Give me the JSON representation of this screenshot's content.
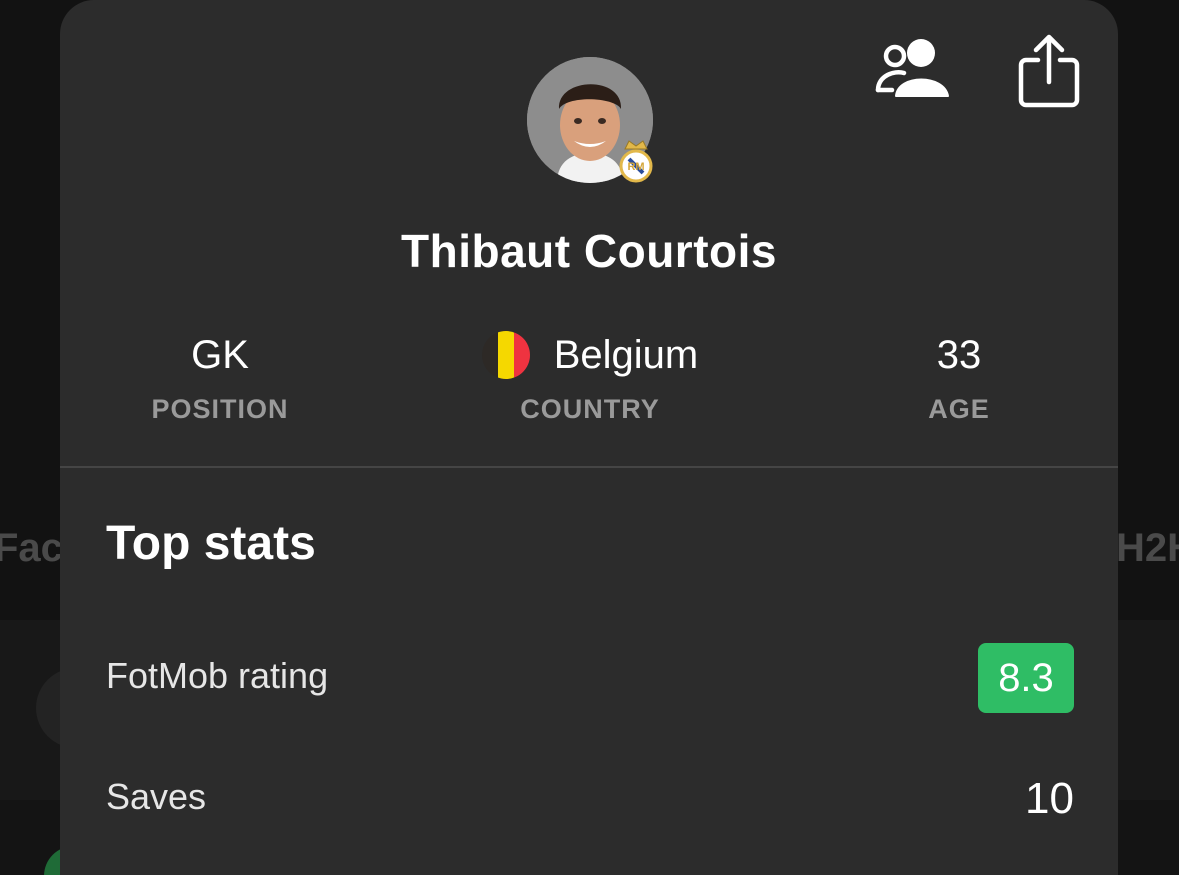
{
  "background": {
    "tab_left_fragment": "Fac",
    "tab_right_fragment": "H2H"
  },
  "header_icons": [
    "compare-players-icon",
    "share-icon"
  ],
  "player": {
    "name": "Thibaut Courtois",
    "club_badge_icon": "real-madrid-crest-icon"
  },
  "info": {
    "position": {
      "value": "GK",
      "label": "POSITION"
    },
    "country": {
      "value": "Belgium",
      "label": "COUNTRY",
      "flag_colors": [
        "#2d2926",
        "#f5d800",
        "#ef3340"
      ]
    },
    "age": {
      "value": "33",
      "label": "AGE"
    }
  },
  "top_stats": {
    "title": "Top stats",
    "rows": [
      {
        "label": "FotMob rating",
        "value": "8.3"
      },
      {
        "label": "Saves",
        "value": "10"
      }
    ]
  },
  "colors": {
    "sheet_background": "#2c2c2c",
    "rating_badge": "#2fbd65",
    "label_grey": "#9a9a9a"
  }
}
